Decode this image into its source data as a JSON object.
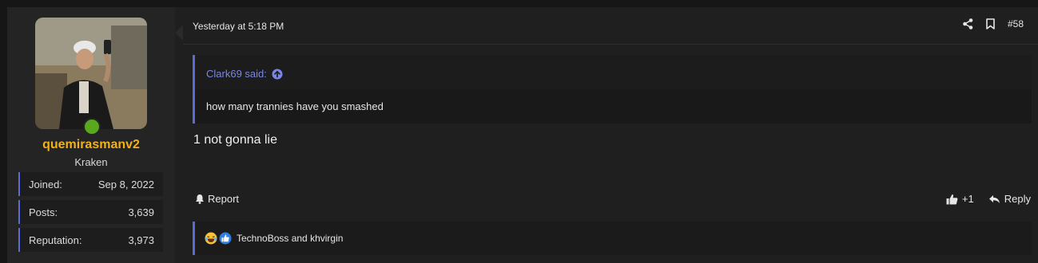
{
  "user": {
    "username": "quemirasmanv2",
    "title": "Kraken",
    "stats": [
      {
        "label": "Joined:",
        "value": "Sep 8, 2022"
      },
      {
        "label": "Posts:",
        "value": "3,639"
      },
      {
        "label": "Reputation:",
        "value": "3,973"
      }
    ]
  },
  "post": {
    "timestamp": "Yesterday at 5:18 PM",
    "number": "#58",
    "quote": {
      "author": "Clark69 said:",
      "text": "how many trannies have you smashed"
    },
    "message": "1 not gonna lie",
    "actions": {
      "report": "Report",
      "like_count": "+1",
      "reply": "Reply"
    },
    "reactions": {
      "names": "TechnoBoss and khvirgin"
    }
  },
  "colors": {
    "accent": "#5a6bd8",
    "username": "#f2b11a",
    "quote_author": "#7b86e8",
    "online": "#5aa81e"
  },
  "icons": [
    "share-icon",
    "bookmark-icon",
    "arrow-up-circle-icon",
    "bell-icon",
    "thumbs-up-icon",
    "reply-icon",
    "laugh-emoji-icon",
    "like-reaction-icon"
  ]
}
